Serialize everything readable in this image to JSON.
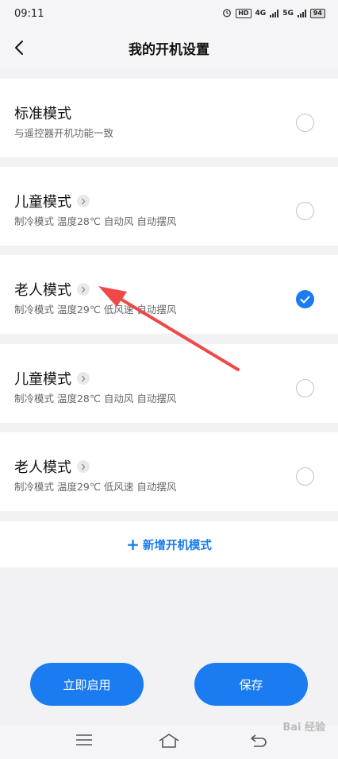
{
  "status_bar": {
    "time": "09:11",
    "hd_label": "HD",
    "network_4g": "4G",
    "network_5g": "5G",
    "battery": "94"
  },
  "header": {
    "title": "我的开机设置"
  },
  "modes": [
    {
      "name": "标准模式",
      "desc": "与遥控器开机功能一致",
      "has_detail": false,
      "selected": false
    },
    {
      "name": "儿童模式",
      "desc": "制冷模式  温度28℃  自动风  自动摆风",
      "has_detail": true,
      "selected": false
    },
    {
      "name": "老人模式",
      "desc": "制冷模式  温度29℃  低风速  自动摆风",
      "has_detail": true,
      "selected": true
    },
    {
      "name": "儿童模式",
      "desc": "制冷模式  温度28℃  自动风  自动摆风",
      "has_detail": true,
      "selected": false
    },
    {
      "name": "老人模式",
      "desc": "制冷模式  温度29℃  低风速  自动摆风",
      "has_detail": true,
      "selected": false
    }
  ],
  "add_mode": {
    "label": "新增开机模式"
  },
  "buttons": {
    "start_now": "立即启用",
    "save": "保存"
  },
  "watermark": "Bai 经验",
  "colors": {
    "accent": "#1a7cf0",
    "annotation_arrow": "#f04848"
  }
}
